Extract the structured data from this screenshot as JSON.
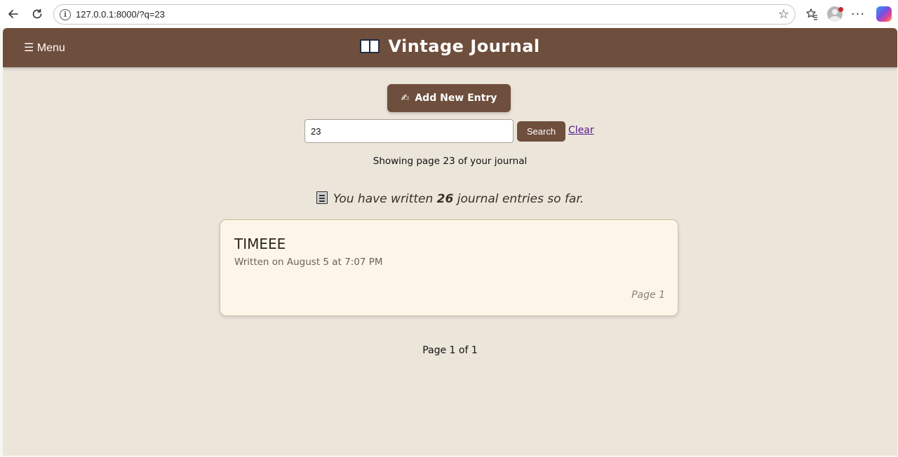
{
  "browser": {
    "url": "127.0.0.1:8000/?q=23"
  },
  "header": {
    "menu_label": "☰ Menu",
    "title": "Vintage Journal"
  },
  "actions": {
    "add_entry_label": "Add New Entry",
    "add_entry_icon": "✍"
  },
  "search": {
    "value": "23",
    "button_label": "Search",
    "clear_label": "Clear"
  },
  "status": {
    "showing_text": "Showing page 23 of your journal",
    "count_prefix": "You have written",
    "count_value": "26",
    "count_suffix": "journal entries so far."
  },
  "entries": [
    {
      "title": "TIMEEE",
      "date": "Written on August 5 at 7:07 PM",
      "page": "Page 1"
    }
  ],
  "pagination": {
    "text": "Page 1 of 1"
  },
  "colors": {
    "header_bg": "#6e4e3c",
    "page_bg": "#ebe5da",
    "card_bg": "#fdf6e8",
    "link": "#551a8b"
  }
}
